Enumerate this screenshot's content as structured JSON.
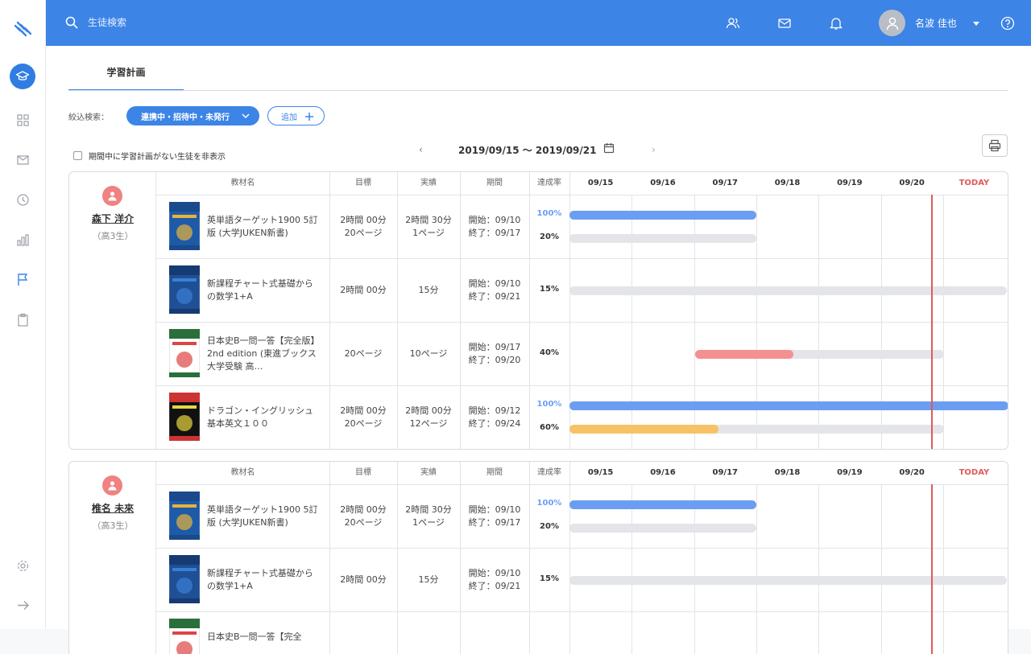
{
  "header": {
    "search_placeholder": "生徒検索",
    "user_name": "名波 佳也"
  },
  "tabs": [
    {
      "label": "学習計画"
    }
  ],
  "filter": {
    "label": "絞込検索：",
    "selected": "連携中・招待中・未発行",
    "add_label": "追加"
  },
  "date_range": "2019/09/15 〜 2019/09/21",
  "hide_checkbox_label": "期間中に学習計画がない生徒を非表示",
  "columns": [
    "教材名",
    "目標",
    "実績",
    "期間",
    "達成率"
  ],
  "days": [
    "09/15",
    "09/16",
    "09/17",
    "09/18",
    "09/19",
    "09/20",
    "TODAY"
  ],
  "colors": {
    "blue": "#6b9ef0",
    "red": "#f59090",
    "orange": "#f7c265",
    "today": "#e05a5a"
  },
  "students": [
    {
      "name": "森下 洋介",
      "grade": "（高3生）",
      "rows": [
        {
          "book": "英単語ターゲット1900 5訂版 (大学JUKEN新書)",
          "goal": [
            "2時間 00分",
            "20ページ"
          ],
          "result": [
            "2時間 30分",
            "1ページ"
          ],
          "period": [
            "開始：09/10",
            "終了：09/17"
          ],
          "rates": [
            "100%",
            "20%"
          ]
        },
        {
          "book": "新課程チャート式基礎からの数学1+A",
          "goal": [
            "2時間 00分"
          ],
          "result": [
            "15分"
          ],
          "period": [
            "開始：09/10",
            "終了：09/21"
          ],
          "rates": [
            "15%"
          ]
        },
        {
          "book": "日本史B一問一答【完全版】2nd edition (東進ブックス 大学受験 高…",
          "goal": [
            "20ページ"
          ],
          "result": [
            "10ページ"
          ],
          "period": [
            "開始：09/17",
            "終了：09/20"
          ],
          "rates": [
            "40%"
          ]
        },
        {
          "book": "ドラゴン・イングリッシュ基本英文１００",
          "goal": [
            "2時間 00分",
            "20ページ"
          ],
          "result": [
            "2時間 00分",
            "12ページ"
          ],
          "period": [
            "開始：09/12",
            "終了：09/24"
          ],
          "rates": [
            "100%",
            "60%"
          ]
        }
      ]
    },
    {
      "name": "椎名 未來",
      "grade": "（高3生）",
      "rows": [
        {
          "book": "英単語ターゲット1900 5訂版 (大学JUKEN新書)",
          "goal": [
            "2時間 00分",
            "20ページ"
          ],
          "result": [
            "2時間 30分",
            "1ページ"
          ],
          "period": [
            "開始：09/10",
            "終了：09/17"
          ],
          "rates": [
            "100%",
            "20%"
          ]
        },
        {
          "book": "新課程チャート式基礎からの数学1+A",
          "goal": [
            "2時間 00分"
          ],
          "result": [
            "15分"
          ],
          "period": [
            "開始：09/10",
            "終了：09/21"
          ],
          "rates": [
            "15%"
          ]
        },
        {
          "book": "日本史B一問一答【完全",
          "goal": [],
          "result": [],
          "period": [],
          "rates": []
        }
      ]
    }
  ]
}
